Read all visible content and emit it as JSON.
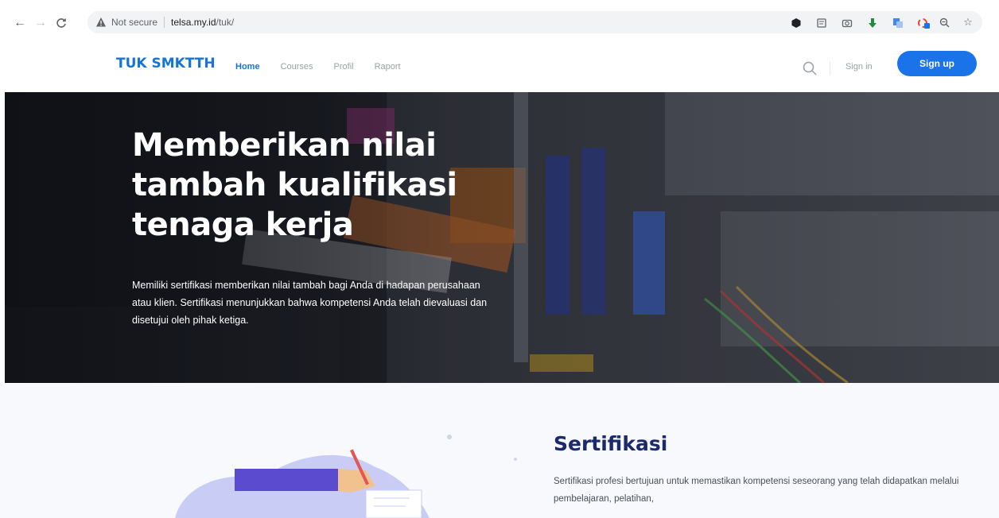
{
  "browser": {
    "back_icon": "arrow-left-icon",
    "forward_icon": "arrow-right-icon",
    "reload_icon": "reload-icon",
    "security_label": "Not secure",
    "url_host": "telsa.my.id",
    "url_path": "/tuk/",
    "toolbar_icons": [
      "zoom-icon",
      "star-icon",
      "extension-icon",
      "reading-list-icon",
      "camera-icon",
      "download-icon",
      "translate-icon",
      "extension-badge-icon"
    ]
  },
  "header": {
    "brand": "TUK SMKTTH",
    "nav": [
      "Home",
      "Courses",
      "Profil",
      "Raport"
    ],
    "active_nav": "Home",
    "signin": "Sign in",
    "signup": "Sign up",
    "accent": "#1a73e8"
  },
  "hero": {
    "title": "Memberikan nilai tambah kualifikasi tenaga kerja",
    "text": "Memiliki sertifikasi memberikan nilai tambah bagi Anda di hadapan perusahaan atau klien. Sertifikasi menunjukkan bahwa kompetensi Anda telah dievaluasi dan disetujui oleh pihak ketiga."
  },
  "section": {
    "title": "Sertifikasi",
    "text": "Sertifikasi profesi bertujuan untuk memastikan kompetensi seseorang yang telah didapatkan melalui pembelajaran, pelatihan,"
  }
}
